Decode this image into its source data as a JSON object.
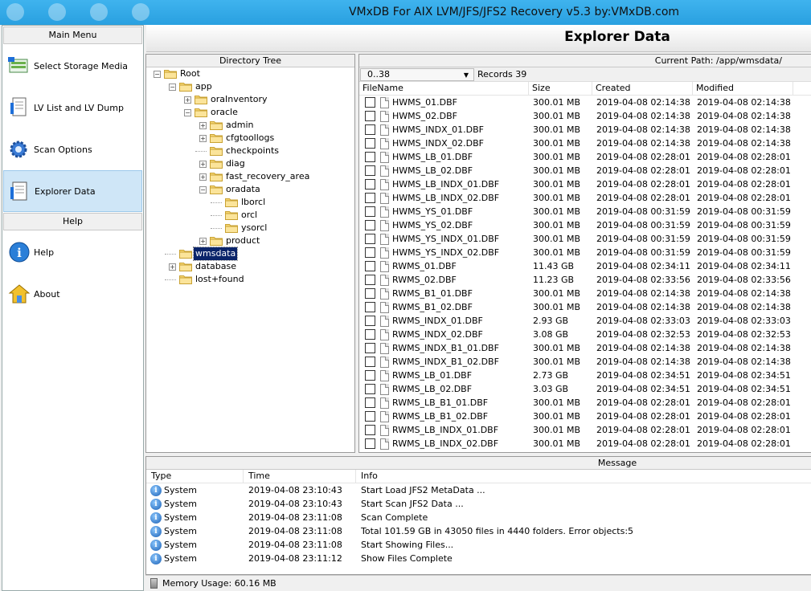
{
  "app": {
    "title": "VMxDB For AIX LVM/JFS/JFS2 Recovery v5.3 by:VMxDB.com"
  },
  "sidebar": {
    "main_menu_label": "Main Menu",
    "help_label": "Help",
    "items": [
      {
        "label": "Select Storage Media",
        "icon": "storage-icon"
      },
      {
        "label": "LV List and LV Dump",
        "icon": "document-icon"
      },
      {
        "label": "Scan Options",
        "icon": "gear-icon"
      },
      {
        "label": "Explorer Data",
        "icon": "explorer-icon"
      }
    ],
    "help_items": [
      {
        "label": "Help",
        "icon": "info-icon"
      },
      {
        "label": "About",
        "icon": "home-icon"
      }
    ]
  },
  "header": {
    "title": "Explorer Data"
  },
  "tree": {
    "caption": "Directory Tree",
    "nodes": [
      "Root",
      "app",
      "oraInventory",
      "oracle",
      "admin",
      "cfgtoollogs",
      "checkpoints",
      "diag",
      "fast_recovery_area",
      "oradata",
      "lborcl",
      "orcl",
      "ysorcl",
      "product",
      "wmsdata",
      "database",
      "lost+found"
    ]
  },
  "filelist": {
    "current_path": "Current Path: /app/wmsdata/",
    "range": "0..38",
    "records": "Records 39",
    "columns": [
      "FileName",
      "Size",
      "Created",
      "Modified"
    ],
    "rows": [
      [
        "HWMS_01.DBF",
        "300.01 MB",
        "2019-04-08 02:14:38",
        "2019-04-08 02:14:38"
      ],
      [
        "HWMS_02.DBF",
        "300.01 MB",
        "2019-04-08 02:14:38",
        "2019-04-08 02:14:38"
      ],
      [
        "HWMS_INDX_01.DBF",
        "300.01 MB",
        "2019-04-08 02:14:38",
        "2019-04-08 02:14:38"
      ],
      [
        "HWMS_INDX_02.DBF",
        "300.01 MB",
        "2019-04-08 02:14:38",
        "2019-04-08 02:14:38"
      ],
      [
        "HWMS_LB_01.DBF",
        "300.01 MB",
        "2019-04-08 02:28:01",
        "2019-04-08 02:28:01"
      ],
      [
        "HWMS_LB_02.DBF",
        "300.01 MB",
        "2019-04-08 02:28:01",
        "2019-04-08 02:28:01"
      ],
      [
        "HWMS_LB_INDX_01.DBF",
        "300.01 MB",
        "2019-04-08 02:28:01",
        "2019-04-08 02:28:01"
      ],
      [
        "HWMS_LB_INDX_02.DBF",
        "300.01 MB",
        "2019-04-08 02:28:01",
        "2019-04-08 02:28:01"
      ],
      [
        "HWMS_YS_01.DBF",
        "300.01 MB",
        "2019-04-08 00:31:59",
        "2019-04-08 00:31:59"
      ],
      [
        "HWMS_YS_02.DBF",
        "300.01 MB",
        "2019-04-08 00:31:59",
        "2019-04-08 00:31:59"
      ],
      [
        "HWMS_YS_INDX_01.DBF",
        "300.01 MB",
        "2019-04-08 00:31:59",
        "2019-04-08 00:31:59"
      ],
      [
        "HWMS_YS_INDX_02.DBF",
        "300.01 MB",
        "2019-04-08 00:31:59",
        "2019-04-08 00:31:59"
      ],
      [
        "RWMS_01.DBF",
        "11.43 GB",
        "2019-04-08 02:34:11",
        "2019-04-08 02:34:11"
      ],
      [
        "RWMS_02.DBF",
        "11.23 GB",
        "2019-04-08 02:33:56",
        "2019-04-08 02:33:56"
      ],
      [
        "RWMS_B1_01.DBF",
        "300.01 MB",
        "2019-04-08 02:14:38",
        "2019-04-08 02:14:38"
      ],
      [
        "RWMS_B1_02.DBF",
        "300.01 MB",
        "2019-04-08 02:14:38",
        "2019-04-08 02:14:38"
      ],
      [
        "RWMS_INDX_01.DBF",
        "2.93 GB",
        "2019-04-08 02:33:03",
        "2019-04-08 02:33:03"
      ],
      [
        "RWMS_INDX_02.DBF",
        "3.08 GB",
        "2019-04-08 02:32:53",
        "2019-04-08 02:32:53"
      ],
      [
        "RWMS_INDX_B1_01.DBF",
        "300.01 MB",
        "2019-04-08 02:14:38",
        "2019-04-08 02:14:38"
      ],
      [
        "RWMS_INDX_B1_02.DBF",
        "300.01 MB",
        "2019-04-08 02:14:38",
        "2019-04-08 02:14:38"
      ],
      [
        "RWMS_LB_01.DBF",
        "2.73 GB",
        "2019-04-08 02:34:51",
        "2019-04-08 02:34:51"
      ],
      [
        "RWMS_LB_02.DBF",
        "3.03 GB",
        "2019-04-08 02:34:51",
        "2019-04-08 02:34:51"
      ],
      [
        "RWMS_LB_B1_01.DBF",
        "300.01 MB",
        "2019-04-08 02:28:01",
        "2019-04-08 02:28:01"
      ],
      [
        "RWMS_LB_B1_02.DBF",
        "300.01 MB",
        "2019-04-08 02:28:01",
        "2019-04-08 02:28:01"
      ],
      [
        "RWMS_LB_INDX_01.DBF",
        "300.01 MB",
        "2019-04-08 02:28:01",
        "2019-04-08 02:28:01"
      ],
      [
        "RWMS_LB_INDX_02.DBF",
        "300.01 MB",
        "2019-04-08 02:28:01",
        "2019-04-08 02:28:01"
      ]
    ]
  },
  "messages": {
    "caption": "Message",
    "columns": [
      "Type",
      "Time",
      "Info"
    ],
    "rows": [
      [
        "System",
        "2019-04-08 23:10:43",
        "Start Load JFS2 MetaData ..."
      ],
      [
        "System",
        "2019-04-08 23:10:43",
        "Start Scan JFS2 Data ..."
      ],
      [
        "System",
        "2019-04-08 23:11:08",
        "Scan Complete"
      ],
      [
        "System",
        "2019-04-08 23:11:08",
        "Total 101.59 GB  in 43050 files in 4440 folders. Error objects:5"
      ],
      [
        "System",
        "2019-04-08 23:11:08",
        "Start Showing Files..."
      ],
      [
        "System",
        "2019-04-08 23:11:12",
        "Show Files Complete"
      ]
    ]
  },
  "status": {
    "memory": "Memory Usage: 60.16 MB"
  }
}
